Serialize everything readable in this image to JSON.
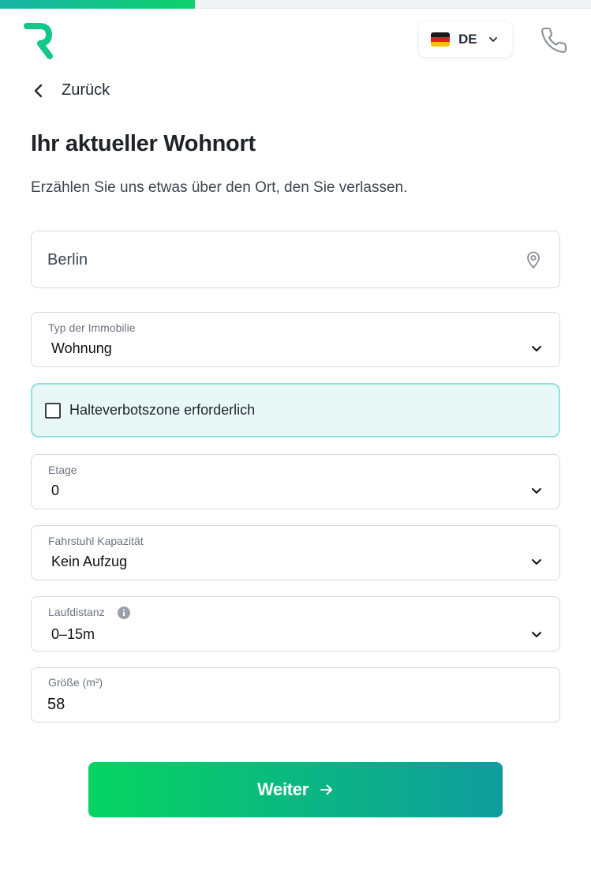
{
  "progress": {
    "fraction": 0.33,
    "fill_color": "#0fd16a"
  },
  "header": {
    "logo_icon": "brand-logo-r",
    "language": {
      "code": "DE",
      "flag_icon": "germany-flag-icon"
    },
    "phone_icon": "phone-icon"
  },
  "nav": {
    "back_label": "Zurück"
  },
  "title": "Ihr aktueller Wohnort",
  "subtitle": "Erzählen Sie uns etwas über den Ort, den Sie verlassen.",
  "form": {
    "location": {
      "value": "Berlin",
      "icon": "location-pin-icon"
    },
    "property_type": {
      "label": "Typ der Immobilie",
      "value": "Wohnung"
    },
    "no_parking_zone": {
      "label": "Halteverbotszone erforderlich",
      "checked": false
    },
    "floor": {
      "label": "Etage",
      "value": "0"
    },
    "elevator": {
      "label": "Fahrstuhl Kapazität",
      "value": "Kein Aufzug"
    },
    "walking_distance": {
      "label": "Laufdistanz",
      "value": "0–15m",
      "info_icon": "info-icon"
    },
    "size": {
      "label": "Größe (m²)",
      "value": "58"
    }
  },
  "submit": {
    "label": "Weiter",
    "icon": "arrow-right-icon"
  },
  "colors": {
    "accent_start": "#06d461",
    "accent_end": "#0f9c9e",
    "highlight_bg": "#e7f8f7",
    "highlight_border": "#8fe3dc"
  }
}
